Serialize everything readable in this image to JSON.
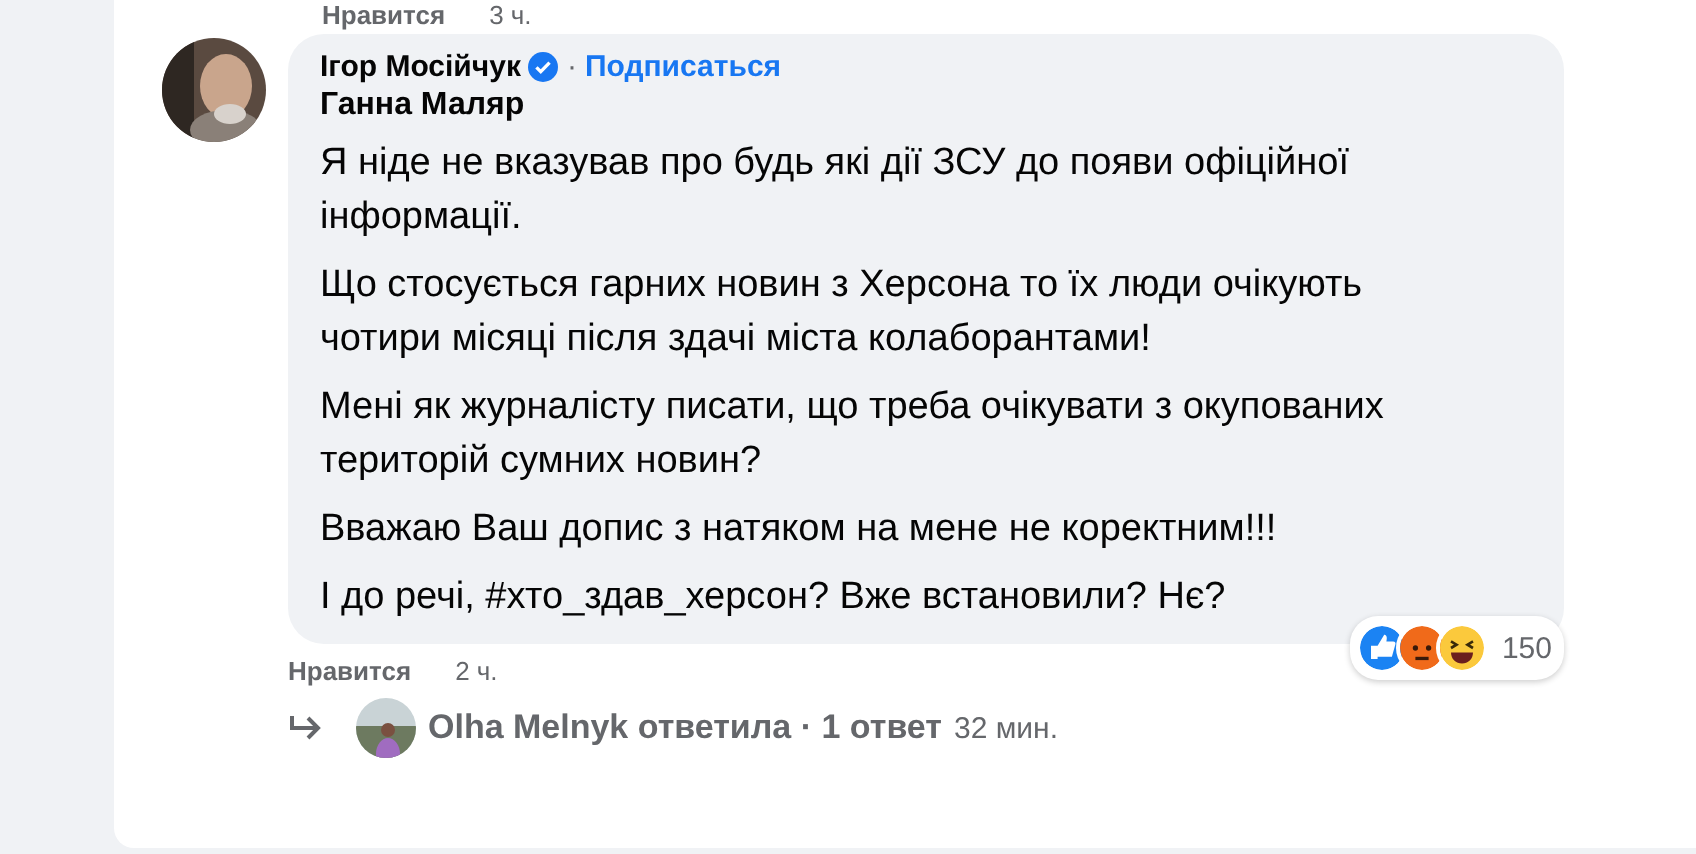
{
  "previous_comment": {
    "like": "Нравится",
    "time": "3 ч."
  },
  "comment": {
    "author": "Ігор Мосійчук",
    "verified": true,
    "separator": "·",
    "follow": "Подписаться",
    "mention": "Ганна Маляр",
    "paragraphs": [
      "Я ніде не вказував про будь які дії ЗСУ до появи офіційної інформації.",
      "Що стосується гарних новин з Херсона то їх люди очікують чотири місяці після здачі міста колаборантами!",
      "Мені як журналісту писати, що треба очікувати з окупованих територій сумних новин?",
      "Вважаю Ваш допис з натяком на мене не коректним!!!",
      "І до речі, #хто_здав_херсон? Вже встановили? Нє?"
    ],
    "reactions": {
      "count": "150"
    },
    "like": "Нравится",
    "time": "2 ч."
  },
  "replies": {
    "text": "Olha Melnyk ответила · 1 ответ",
    "time": "32 мин."
  }
}
